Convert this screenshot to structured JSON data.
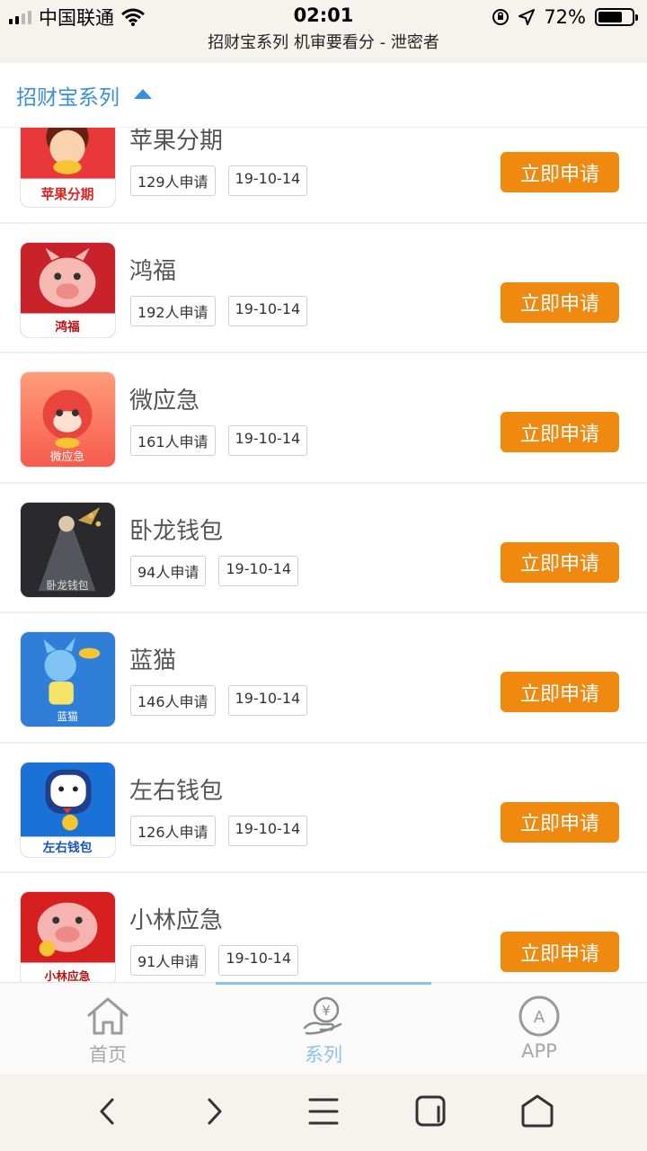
{
  "status_bar": {
    "carrier": "中国联通",
    "time": "02:01",
    "battery": "72%",
    "battery_level": 0.72,
    "page_subtitle": "招财宝系列 机审要看分 - 泄密者"
  },
  "category": {
    "title": "招财宝系列"
  },
  "apply_label": "立即申请",
  "items": [
    {
      "name": "苹果分期",
      "applicants": "129人申请",
      "date": "19-10-14",
      "logo_text": "苹果分期"
    },
    {
      "name": "鸿福",
      "applicants": "192人申请",
      "date": "19-10-14",
      "logo_text": "鸿福"
    },
    {
      "name": "微应急",
      "applicants": "161人申请",
      "date": "19-10-14",
      "logo_text": "微应急"
    },
    {
      "name": "卧龙钱包",
      "applicants": "94人申请",
      "date": "19-10-14",
      "logo_text": "卧龙钱包"
    },
    {
      "name": "蓝猫",
      "applicants": "146人申请",
      "date": "19-10-14",
      "logo_text": "蓝猫"
    },
    {
      "name": "左右钱包",
      "applicants": "126人申请",
      "date": "19-10-14",
      "logo_text": "左右钱包"
    },
    {
      "name": "小林应急",
      "applicants": "91人申请",
      "date": "19-10-14",
      "logo_text": "小林应急"
    }
  ],
  "tabbar": {
    "home": "首页",
    "series": "系列",
    "app": "APP",
    "app_icon_letter": "A",
    "active": "series"
  },
  "colors": {
    "accent_blue": "#3a8fd8",
    "button_orange": "#f0890f",
    "tab_active": "#8cc3ec"
  },
  "icons": [
    "signal-icon",
    "wifi-icon",
    "orientation-lock-icon",
    "location-arrow-icon",
    "battery-icon",
    "caret-up-icon",
    "home-icon",
    "money-hand-icon",
    "app-circle-icon",
    "back-icon",
    "forward-icon",
    "menu-icon",
    "tabs-icon",
    "home-hexagon-icon"
  ]
}
